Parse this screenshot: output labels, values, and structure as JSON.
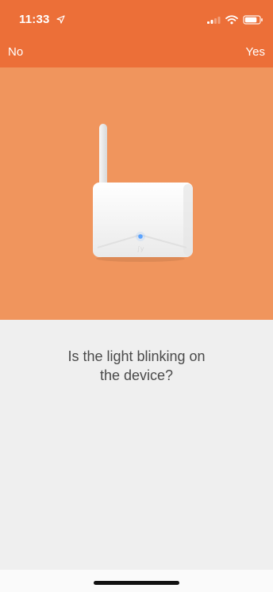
{
  "status_bar": {
    "time": "11:33",
    "location_icon": "location-arrow-icon",
    "signal_icon": "cellular-signal-icon",
    "wifi_icon": "wifi-icon",
    "battery_icon": "battery-icon"
  },
  "nav": {
    "left_label": "No",
    "right_label": "Yes"
  },
  "hero": {
    "device_icon": "router-device-icon",
    "device_logo_text": "∫y"
  },
  "question": {
    "line1": "Is the light blinking on",
    "line2": "the device?"
  },
  "colors": {
    "header": "#ec6f38",
    "hero": "#f0955d",
    "content_bg": "#efefef",
    "text": "#4a4a4a",
    "white": "#ffffff"
  }
}
